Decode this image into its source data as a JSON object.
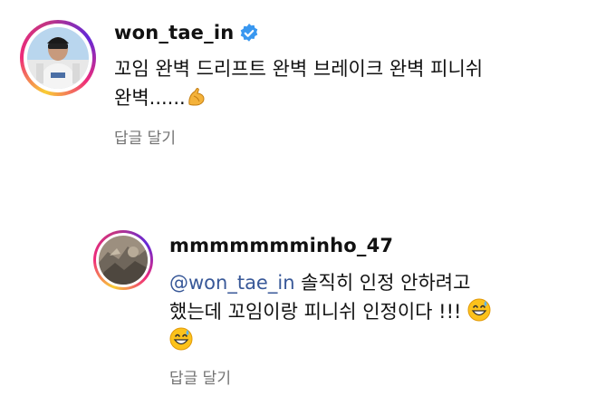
{
  "comments": [
    {
      "username": "won_tae_in",
      "text_line1": "꼬임 완벽 드리프트 완벽 브레이크 완벽 피니쉬",
      "text_line2": "완벽......",
      "reply_label": "답글 달기",
      "verified": true,
      "emoji": [
        "flexed-biceps"
      ]
    },
    {
      "username": "mmmmmmminho_47",
      "mention": "@won_tae_in",
      "text_line1": " 솔직히 인정 안하려고",
      "text_line2": "했는데 꼬임이랑 피니쉬 인정이다 !!! ",
      "reply_label": "답글 달기",
      "emoji": [
        "grinning-sweat-face",
        "grinning-sweat-face"
      ]
    }
  ],
  "colors": {
    "verified_badge": "#3897f0",
    "mention": "#385898",
    "secondary_text": "#737373"
  }
}
